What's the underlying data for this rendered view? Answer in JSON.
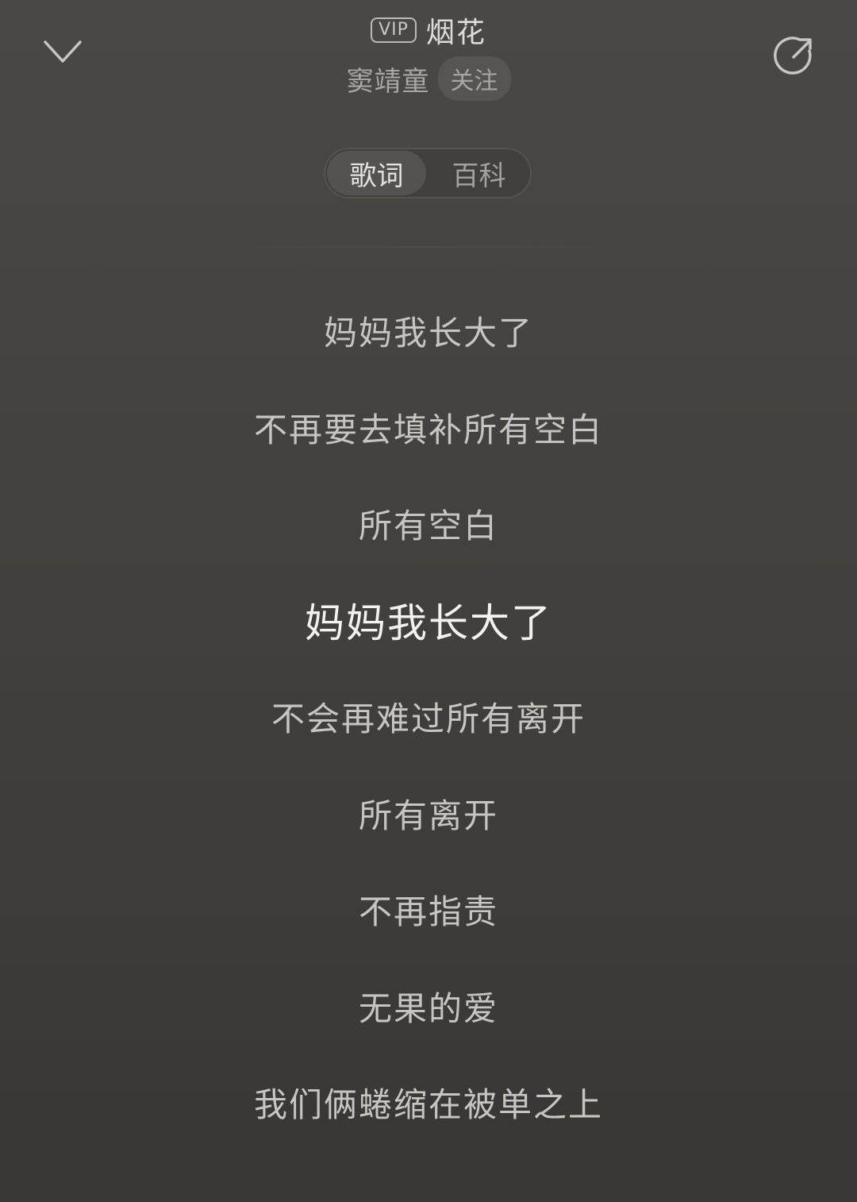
{
  "header": {
    "vip_label": "VIP",
    "song_title": "烟花",
    "artist": "窦靖童",
    "follow_label": "关注",
    "collapse_icon": "chevron-down-icon",
    "share_icon": "share-icon"
  },
  "tabs": [
    {
      "label": "歌词",
      "active": true
    },
    {
      "label": "百科",
      "active": false
    }
  ],
  "lyrics": {
    "current_index": 3,
    "lines": [
      "妈妈我长大了",
      "不再要去填补所有空白",
      "所有空白",
      "妈妈我长大了",
      "不会再难过所有离开",
      "所有离开",
      "不再指责",
      "无果的爱",
      "我们俩蜷缩在被单之上"
    ]
  },
  "colors": {
    "background_top": "#4a4845",
    "background_bottom": "#393734",
    "current_lyric": "#f4f2ef",
    "lyric": "#c8c5c0"
  }
}
